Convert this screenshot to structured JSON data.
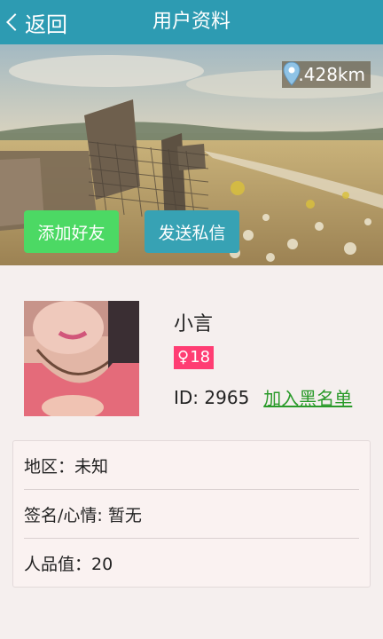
{
  "header": {
    "back_label": "返回",
    "title": "用户资料"
  },
  "hero": {
    "distance": "4.428km",
    "add_friend_label": "添加好友",
    "send_message_label": "发送私信"
  },
  "profile": {
    "name": "小言",
    "gender_symbol": "♀",
    "age": "18",
    "id_label": "ID: 2965",
    "blacklist_label": "加入黑名单"
  },
  "info": {
    "region": "地区：未知",
    "signature": "签名/心情: 暂无",
    "karma": "人品值：20"
  },
  "colors": {
    "header_bg": "#2d9bb2",
    "add_friend_bg": "#4cd964",
    "send_message_bg": "#37a2b4",
    "badge_bg": "#ff3d73",
    "link": "#2a9a2a"
  }
}
